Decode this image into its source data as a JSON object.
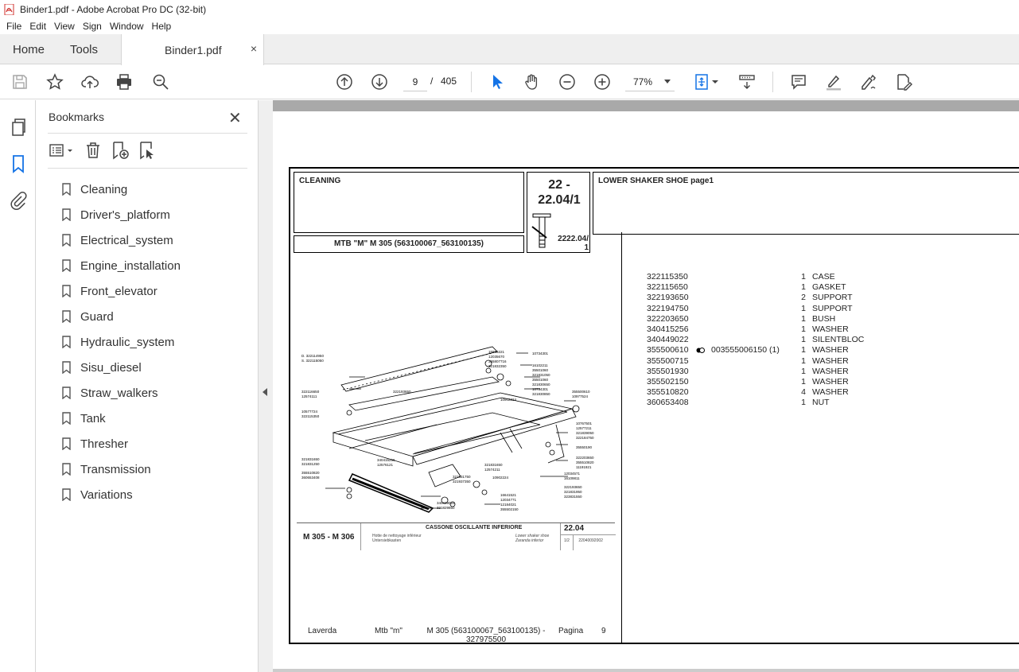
{
  "window": {
    "title": "Binder1.pdf - Adobe Acrobat Pro DC (32-bit)"
  },
  "menu": [
    "File",
    "Edit",
    "View",
    "Sign",
    "Window",
    "Help"
  ],
  "tabs": {
    "home": "Home",
    "tools": "Tools",
    "doc": "Binder1.pdf",
    "close": "×"
  },
  "toolbar": {
    "page_current": "9",
    "page_sep": "/",
    "page_total": "405",
    "zoom": "77%"
  },
  "bookmarks": {
    "title": "Bookmarks",
    "close": "✕",
    "items": [
      "Cleaning",
      "Driver's_platform",
      "Electrical_system",
      "Engine_installation",
      "Front_elevator",
      "Guard",
      "Hydraulic_system",
      "Sisu_diesel",
      "Straw_walkers",
      "Tank",
      "Thresher",
      "Transmission",
      "Variations"
    ]
  },
  "document": {
    "section": "CLEANING",
    "model_box": "MTB \"M\" M 305 (563100067_563100135)",
    "number_main": "22 -\n22.04/1",
    "number_sub_1": "2222.04/",
    "number_sub_2": "1",
    "heading": "LOWER SHAKER SHOE  page1",
    "parts": [
      {
        "code": "322115350",
        "ref": "",
        "qty": "1",
        "desc": "CASE"
      },
      {
        "code": "322115650",
        "ref": "",
        "qty": "1",
        "desc": "GASKET"
      },
      {
        "code": "322193650",
        "ref": "",
        "qty": "2",
        "desc": "SUPPORT"
      },
      {
        "code": "322194750",
        "ref": "",
        "qty": "1",
        "desc": "SUPPORT"
      },
      {
        "code": "322203650",
        "ref": "",
        "qty": "1",
        "desc": "BUSH"
      },
      {
        "code": "340415256",
        "ref": "",
        "qty": "1",
        "desc": "WASHER"
      },
      {
        "code": "340449022",
        "ref": "",
        "qty": "1",
        "desc": "SILENTBLOC"
      },
      {
        "code": "355500610",
        "ref": "003555006150  (1)",
        "qty": "1",
        "desc": "WASHER"
      },
      {
        "code": "355500715",
        "ref": "",
        "qty": "1",
        "desc": "WASHER"
      },
      {
        "code": "355501930",
        "ref": "",
        "qty": "1",
        "desc": "WASHER"
      },
      {
        "code": "355502150",
        "ref": "",
        "qty": "1",
        "desc": "WASHER"
      },
      {
        "code": "355510820",
        "ref": "",
        "qty": "4",
        "desc": "WASHER"
      },
      {
        "code": "360653408",
        "ref": "",
        "qty": "1",
        "desc": "NUT"
      }
    ],
    "caption": {
      "model": "M 305 - M 306",
      "title": "CASSONE OSCILLANTE INFERIORE",
      "left_small": "Hotte de nettoyage inférieur\nUntersiebkasten",
      "right_small": "Lower shaker shoe\nZaranda inferior",
      "number": "22.04",
      "tiny_a": "1/2",
      "tiny_b": "22040092002"
    },
    "footer": {
      "brand": "Laverda",
      "mtb": "Mtb \"m\"",
      "model": "M 305 (563100067_563100135)  -\n327975500",
      "pagina": "Pagina",
      "page": "9"
    }
  }
}
